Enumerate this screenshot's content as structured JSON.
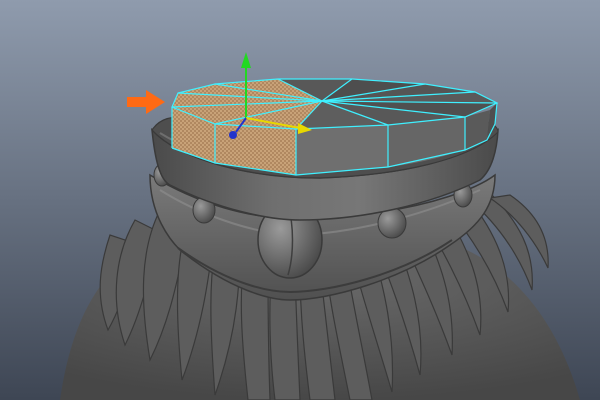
{
  "viewport": {
    "background_top": "#8f9bad",
    "background_bottom": "#3e4654"
  },
  "model": {
    "body_color": "#6d6d6d",
    "body_dark": "#4b4b4b",
    "body_light": "#8a8a8a"
  },
  "selection": {
    "face_highlight_color": "#c8a278",
    "wireframe_color": "#3ff0ff",
    "selected_faces": 5,
    "total_cap_faces": 10
  },
  "manipulator": {
    "y_axis_color": "#22d822",
    "x_axis_color": "#e8d800",
    "z_axis_color": "#2233cc"
  },
  "annotation": {
    "arrow_color": "#ff6a14",
    "arrow_icon": "arrow-right-icon"
  }
}
